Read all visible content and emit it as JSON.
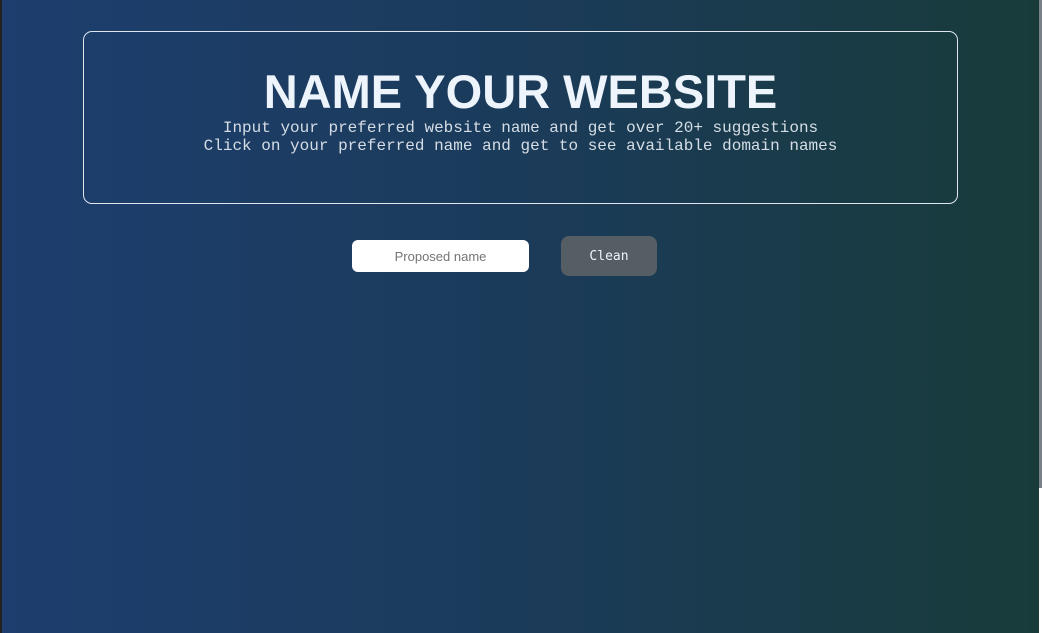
{
  "header": {
    "title": "NAME YOUR WEBSITE",
    "line1": "Input your preferred website name and get over 20+ suggestions",
    "line2": "Click on your preferred name and get to see available domain names"
  },
  "form": {
    "name_placeholder": "Proposed name",
    "name_value": "",
    "clean_label": "Clean"
  }
}
